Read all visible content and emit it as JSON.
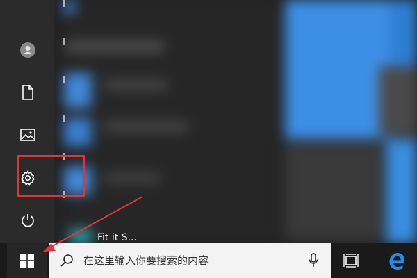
{
  "start_menu": {
    "rail_items": [
      {
        "icon": "user-account-icon"
      },
      {
        "icon": "documents-icon"
      },
      {
        "icon": "pictures-icon"
      },
      {
        "icon": "gear-icon"
      },
      {
        "icon": "power-icon"
      }
    ],
    "peek_text": "Fit it S...",
    "highlight_color": "#e23535"
  },
  "taskbar": {
    "start_icon": "windows-logo-icon",
    "search": {
      "icon": "search-icon",
      "placeholder": "在这里输入你要搜索的内容",
      "mic_icon": "microphone-icon"
    },
    "task_view_icon": "task-view-icon",
    "edge_icon": "edge-browser-icon"
  },
  "annotation": {
    "arrow_color": "#e23535"
  }
}
